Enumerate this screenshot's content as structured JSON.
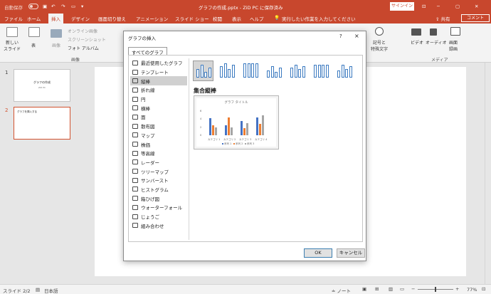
{
  "titlebar": {
    "autosave": "自動保存",
    "filename": "グラフの作成.pptx  -  ZiD PC に保存済み",
    "signin": "サインイン"
  },
  "tabs": [
    "ファイル",
    "ホーム",
    "挿入",
    "デザイン",
    "画面切り替え",
    "アニメーション",
    "スライド ショー",
    "校閲",
    "表示",
    "ヘルプ"
  ],
  "tell_me": "実行したい作業を入力してください",
  "share": "共有",
  "comment": "コメント",
  "ribbon": {
    "new_slide": "新しい\nスライド",
    "table": "表",
    "image": "画像",
    "online_image": "オンライン画像",
    "screenshot": "スクリーンショット",
    "photo_album": "フォト アルバム",
    "group_image": "画像",
    "symbols": "記号と\n特殊文字",
    "video": "ビデオ",
    "audio": "オーディオ",
    "screen_record": "画面\n録画",
    "group_media": "メディア"
  },
  "slides": [
    {
      "num": "1",
      "title": "グラフの作成",
      "sub": "ZiD PC"
    },
    {
      "num": "2",
      "title": "グラフを挿入する"
    }
  ],
  "status": {
    "slide": "スライド 2/2",
    "lang": "日本語",
    "notes": "ノート",
    "zoom": "77%"
  },
  "dialog": {
    "title": "グラフの挿入",
    "help": "?",
    "close": "×",
    "tab": "すべてのグラフ",
    "types": [
      "最近使用したグラフ",
      "テンプレート",
      "縦棒",
      "折れ線",
      "円",
      "横棒",
      "面",
      "散布図",
      "マップ",
      "株価",
      "等高線",
      "レーダー",
      "ツリーマップ",
      "サンバースト",
      "ヒストグラム",
      "箱ひげ図",
      "ウォーターフォール",
      "じょうご",
      "組み合わせ"
    ],
    "selected_type": "縦棒",
    "subtype_name": "集合縦棒",
    "preview_title": "グラフ タイトル",
    "ok": "OK",
    "cancel": "キャンセル"
  },
  "chart_data": {
    "type": "bar",
    "title": "グラフ タイトル",
    "categories": [
      "カテゴリ 1",
      "カテゴリ 2",
      "カテゴリ 3",
      "カテゴリ 4"
    ],
    "series": [
      {
        "name": "系列 1",
        "values": [
          4.3,
          2.5,
          3.5,
          4.5
        ]
      },
      {
        "name": "系列 2",
        "values": [
          2.4,
          4.4,
          1.8,
          2.8
        ]
      },
      {
        "name": "系列 3",
        "values": [
          2,
          2,
          3,
          5
        ]
      }
    ],
    "ylim": [
      0,
      6
    ],
    "yticks": [
      "0",
      "2",
      "4",
      "6"
    ],
    "colors": [
      "#4472c4",
      "#ed7d31",
      "#a5a5a5"
    ]
  }
}
